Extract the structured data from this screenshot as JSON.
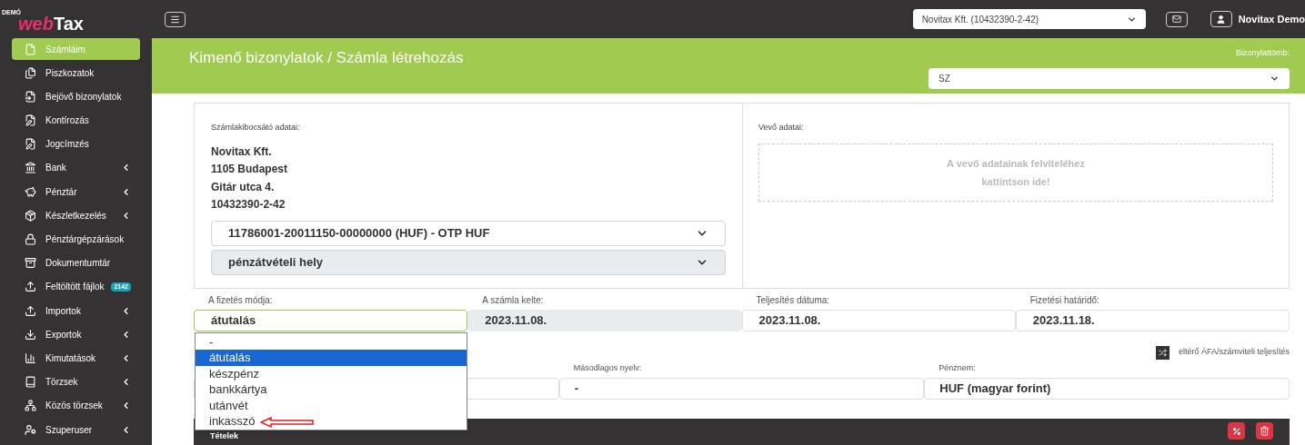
{
  "logo": {
    "badge": "DEMÓ",
    "accent": "web",
    "name": "Tax"
  },
  "topbar": {
    "company_select": "Novitax Kft. (10432390-2-42)",
    "user": "Novitax Demo"
  },
  "sidebar": {
    "items": [
      {
        "label": "Számláim",
        "selected": true,
        "submenu": false
      },
      {
        "label": "Piszkozatok",
        "selected": false,
        "submenu": false
      },
      {
        "label": "Bejövő bizonylatok",
        "selected": false,
        "submenu": false
      },
      {
        "label": "Kontírozás",
        "selected": false,
        "submenu": false
      },
      {
        "label": "Jogcímzés",
        "selected": false,
        "submenu": false
      },
      {
        "label": "Bank",
        "selected": false,
        "submenu": true
      },
      {
        "label": "Pénztár",
        "selected": false,
        "submenu": true
      },
      {
        "label": "Készletkezelés",
        "selected": false,
        "submenu": true
      },
      {
        "label": "Pénztárgépzárások",
        "selected": false,
        "submenu": false
      },
      {
        "label": "Dokumentumtár",
        "selected": false,
        "submenu": false
      },
      {
        "label": "Feltöltött fájlok",
        "selected": false,
        "submenu": false,
        "badge": "2142"
      },
      {
        "label": "Importok",
        "selected": false,
        "submenu": true
      },
      {
        "label": "Exportok",
        "selected": false,
        "submenu": true
      },
      {
        "label": "Kimutatások",
        "selected": false,
        "submenu": true
      },
      {
        "label": "Törzsek",
        "selected": false,
        "submenu": true
      },
      {
        "label": "Közös törzsek",
        "selected": false,
        "submenu": true
      },
      {
        "label": "Szuperuser",
        "selected": false,
        "submenu": true
      }
    ]
  },
  "header": {
    "title": "Kimenő bizonylatok / Számla létrehozás",
    "block_label": "Bizonylattömb:",
    "block_value": "SZ"
  },
  "seller": {
    "label": "Számlakibocsátó adatai:",
    "lines": [
      "Novitax Kft.",
      "1105 Budapest",
      "Gitár utca 4.",
      "10432390-2-42"
    ],
    "bank_account": "11786001-20011150-00000000 (HUF) - OTP HUF",
    "cash_point": "pénzátvételi hely"
  },
  "buyer": {
    "label": "Vevő adatai:",
    "prompt": "A vevő adatainak felviteléhez kattintson ide!"
  },
  "fields": [
    {
      "label": "A fizetés módja:",
      "value": "átutalás",
      "disabled": false,
      "focused": true
    },
    {
      "label": "A számla kelte:",
      "value": "2023.11.08.",
      "disabled": true,
      "focused": false
    },
    {
      "label": "Teljesítés dátuma:",
      "value": "2023.11.08.",
      "disabled": false,
      "focused": false
    },
    {
      "label": "Fizetési határidő:",
      "value": "2023.11.18.",
      "disabled": false,
      "focused": false
    }
  ],
  "different_vat_label": "eltérő ÁFA/számviteli teljesítés",
  "fields2": [
    {
      "label": "Másodlagos nyelv:",
      "value": "-"
    },
    {
      "label": "Pénznem:",
      "value": "HUF (magyar forint)"
    }
  ],
  "payment_options": [
    {
      "label": "-",
      "selected": false
    },
    {
      "label": "átutalás",
      "selected": true
    },
    {
      "label": "készpénz",
      "selected": false
    },
    {
      "label": "bankkártya",
      "selected": false
    },
    {
      "label": "utánvét",
      "selected": false
    },
    {
      "label": "inkasszó",
      "selected": false
    }
  ],
  "items_bar": {
    "title": "Tételek"
  }
}
